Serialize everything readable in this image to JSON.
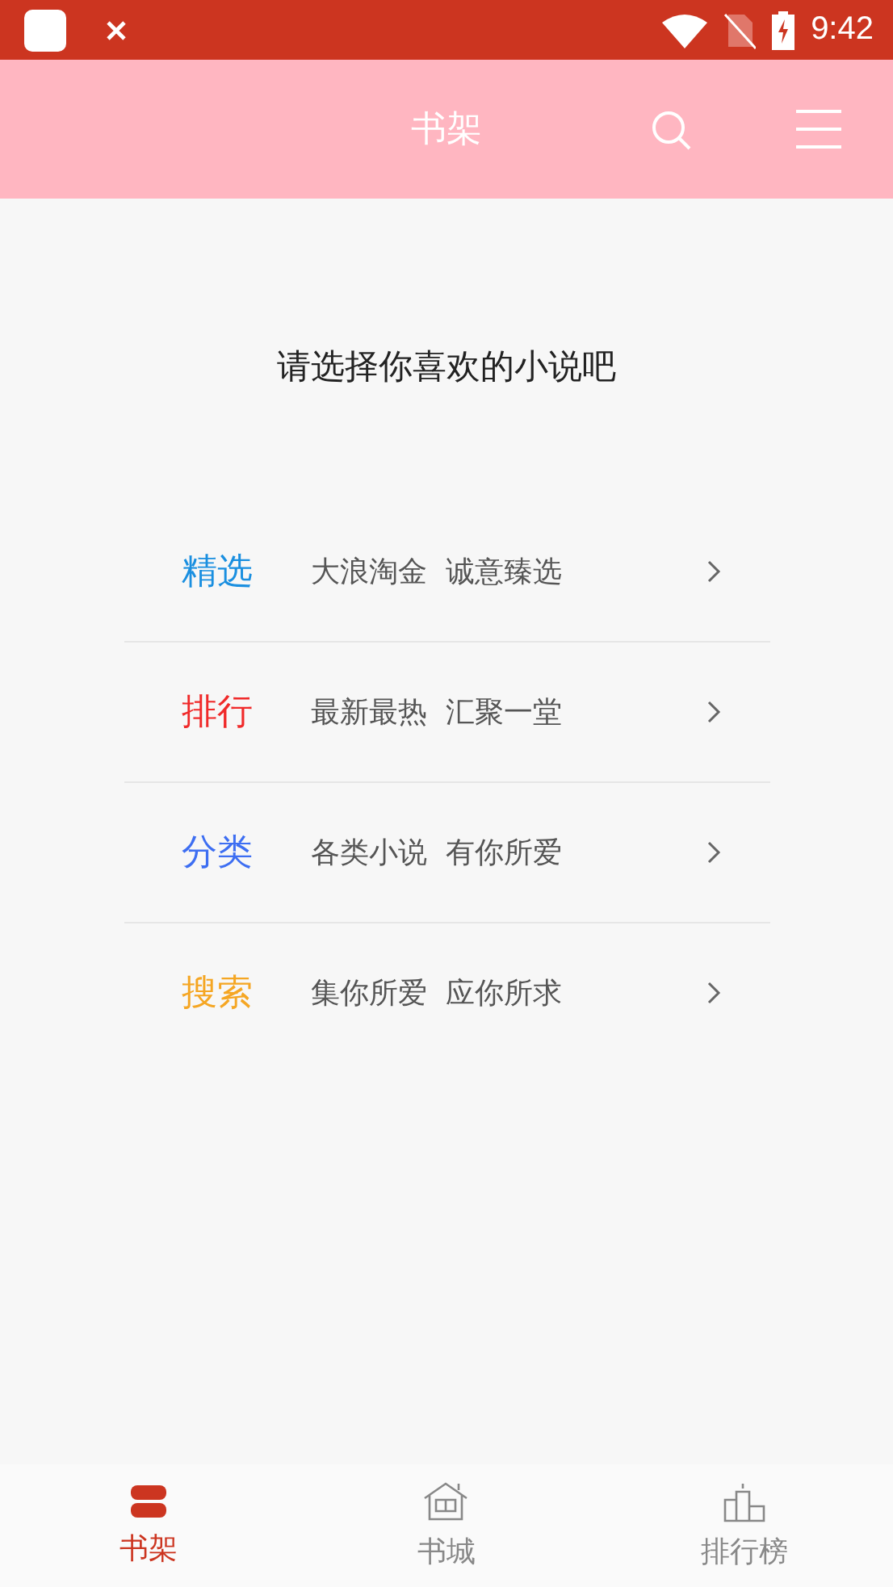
{
  "status_bar": {
    "time": "9:42"
  },
  "header": {
    "title": "书架"
  },
  "prompt": "请选择你喜欢的小说吧",
  "menu": [
    {
      "label": "精选",
      "color": "#1a8fe0",
      "tagline": "大浪淘金  诚意臻选"
    },
    {
      "label": "排行",
      "color": "#f02a2a",
      "tagline": "最新最热  汇聚一堂"
    },
    {
      "label": "分类",
      "color": "#3d6ef2",
      "tagline": "各类小说  有你所爱"
    },
    {
      "label": "搜索",
      "color": "#f5a623",
      "tagline": "集你所爱  应你所求"
    }
  ],
  "tabs": [
    {
      "label": "书架",
      "kind": "shelf",
      "selected": true
    },
    {
      "label": "书城",
      "kind": "store",
      "selected": false
    },
    {
      "label": "排行榜",
      "kind": "rank",
      "selected": false
    }
  ]
}
